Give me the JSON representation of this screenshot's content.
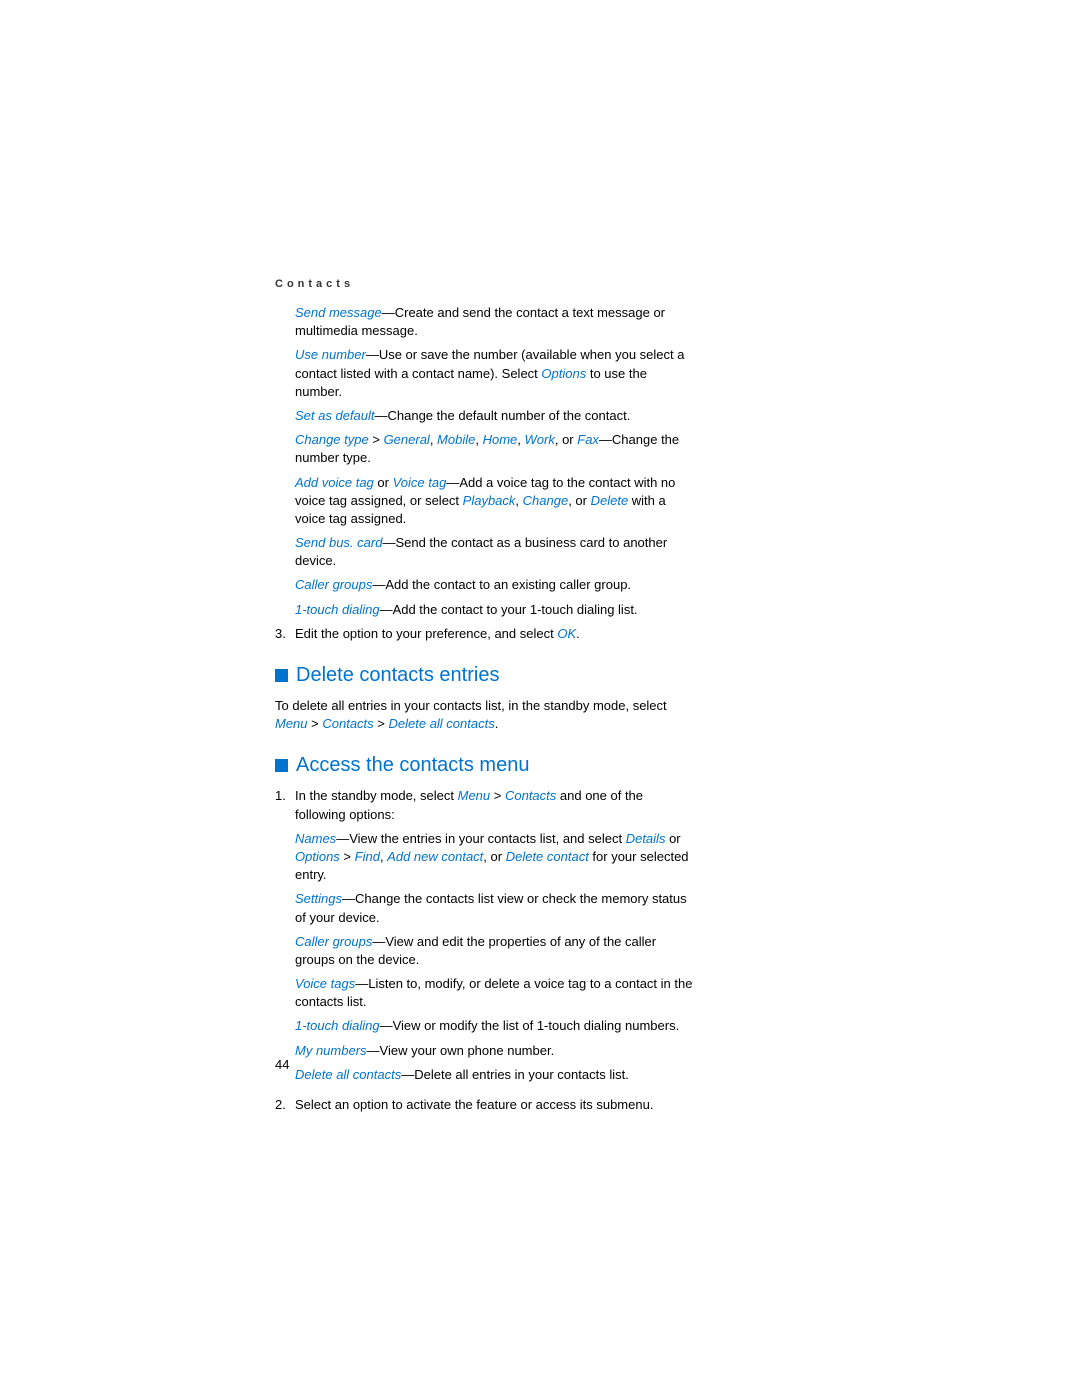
{
  "header": "Contacts",
  "body": {
    "sendMessage": {
      "term": "Send message",
      "text": "—Create and send the contact a text message or multimedia message."
    },
    "useNumber": {
      "term": "Use number",
      "text1": "—Use or save the number (available when you select a contact listed with a contact name). Select ",
      "opt": "Options",
      "text2": " to use the number."
    },
    "setDefault": {
      "term": "Set as default",
      "text": "—Change the default number of the contact."
    },
    "changeType": {
      "term": "Change type",
      "gt": " > ",
      "g": "General",
      "m": "Mobile",
      "h": "Home",
      "w": "Work",
      "fax": "Fax",
      "c1": ", ",
      "c2": ", ",
      "c3": ", ",
      "or": ", or ",
      "text": "—Change the number type."
    },
    "addVoice": {
      "t1": "Add voice tag",
      "or1": " or ",
      "t2": "Voice tag",
      "text1": "—Add a voice tag to the contact with no voice tag assigned, or select ",
      "p": "Playback",
      "c1": ", ",
      "ch": "Change",
      "or2": ", or ",
      "d": "Delete",
      "text2": " with a voice tag assigned."
    },
    "sendBus": {
      "term": "Send bus. card",
      "text": "—Send the contact as a business card to another device."
    },
    "callerGroups": {
      "term": "Caller groups",
      "text": "—Add the contact to an existing caller group."
    },
    "oneTouch": {
      "term": "1-touch dialing",
      "text": "—Add the contact to your 1-touch dialing list."
    },
    "step3": {
      "num": "3.",
      "text1": "Edit the option to your preference, and select ",
      "ok": "OK",
      "text2": "."
    }
  },
  "section1": {
    "heading": "Delete contacts entries",
    "p": {
      "text1": "To delete all entries in your contacts list, in the standby mode, select ",
      "m": "Menu",
      "gt1": " > ",
      "c": "Contacts",
      "gt2": " > ",
      "d": "Delete all contacts",
      "text2": "."
    }
  },
  "section2": {
    "heading": "Access the contacts menu",
    "step1": {
      "num": "1.",
      "intro": {
        "text1": "In the standby mode, select ",
        "m": "Menu",
        "gt": " > ",
        "c": "Contacts",
        "text2": " and one of the following options:"
      },
      "names": {
        "term": "Names",
        "text1": "—View the entries in your contacts list, and select ",
        "d": "Details",
        "or1": " or ",
        "o": "Options",
        "gt": " > ",
        "f": "Find",
        "c1": ", ",
        "a": "Add new contact",
        "or2": ", or ",
        "del": "Delete contact",
        "text2": " for your selected entry."
      },
      "settings": {
        "term": "Settings",
        "text": "—Change the contacts list view or check the memory status of your device."
      },
      "caller": {
        "term": "Caller groups",
        "text": "—View and edit the properties of any of the caller groups on the device."
      },
      "voice": {
        "term": "Voice tags",
        "text": "—Listen to, modify, or delete a voice tag to a contact in the contacts list."
      },
      "onetouch": {
        "term": "1-touch dialing",
        "text": "—View or modify the list of 1-touch dialing numbers."
      },
      "mynum": {
        "term": "My numbers",
        "text": "—View your own phone number."
      },
      "delall": {
        "term": "Delete all contacts",
        "text": "—Delete all entries in your contacts list."
      }
    },
    "step2": {
      "num": "2.",
      "text": "Select an option to activate the feature or access its submenu."
    }
  },
  "pageNumber": "44"
}
